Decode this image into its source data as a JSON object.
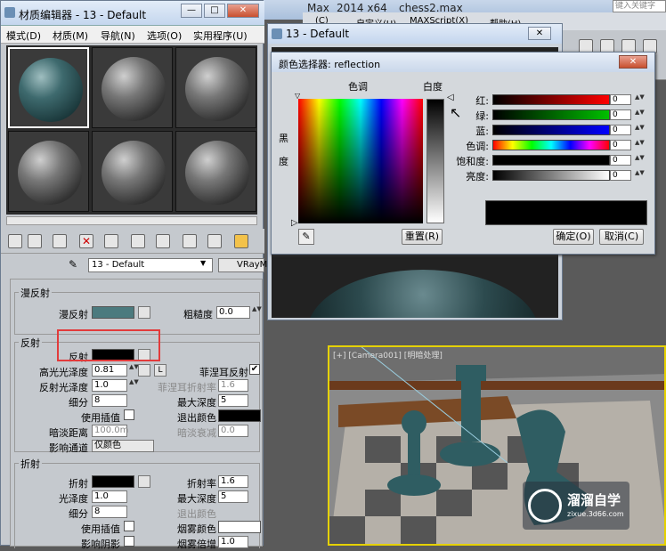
{
  "app": {
    "title_fragments": [
      "Max",
      "2014 x64",
      "chess2.max"
    ],
    "search_placeholder": "键入关键字",
    "menu_fragments": [
      "(C)",
      "自定义(U)",
      "MAXScript(X)",
      "帮助(H)"
    ]
  },
  "viewport": {
    "label": "[+] [Camera001] [明暗处理]"
  },
  "material_editor": {
    "title": "材质编辑器 - 13 - Default",
    "window_buttons": [
      "—",
      "□",
      "✕"
    ],
    "menu": [
      "模式(D)",
      "材质(M)",
      "导航(N)",
      "选项(O)",
      "实用程序(U)"
    ],
    "material_name": "13 - Default",
    "material_type": "VRayMt",
    "diffuse": {
      "header": "漫反射",
      "diffuse_label": "漫反射",
      "diffuse_color": "#4b7a7e",
      "roughness_label": "粗糙度",
      "roughness_value": "0.0"
    },
    "reflection": {
      "header": "反射",
      "reflect_label": "反射",
      "reflect_color": "#000000",
      "hilight_gloss_label": "高光光泽度",
      "hilight_gloss_value": "0.81",
      "lock_label": "L",
      "fresnel_label": "菲涅耳反射",
      "fresnel_checked": "✔",
      "refl_gloss_label": "反射光泽度",
      "refl_gloss_value": "1.0",
      "fresnel_ior_label": "菲涅耳折射率",
      "fresnel_ior_value": "1.6",
      "subdivs_label": "细分",
      "subdivs_value": "8",
      "max_depth_label": "最大深度",
      "max_depth_value": "5",
      "use_interp_label": "使用插值",
      "exit_color_label": "退出颜色",
      "exit_color": "#000000",
      "dim_dist_label": "暗淡距离",
      "dim_dist_value": "100.0m",
      "dim_falloff_label": "暗淡衰减",
      "dim_falloff_value": "0.0",
      "affect_channels_label": "影响通道",
      "affect_channels_value": "仅颜色"
    },
    "refraction": {
      "header": "折射",
      "refract_label": "折射",
      "refract_color": "#000000",
      "ior_label": "折射率",
      "ior_value": "1.6",
      "gloss_label": "光泽度",
      "gloss_value": "1.0",
      "max_depth_label": "最大深度",
      "max_depth_value": "5",
      "subdivs_label": "细分",
      "subdivs_value": "8",
      "exit_color_label": "退出颜色",
      "use_interp_label": "使用插值",
      "fog_color_label": "烟雾颜色",
      "fog_color": "#ffffff",
      "affect_shadows_label": "影响阴影",
      "fog_mult_label": "烟雾倍增",
      "fog_mult_value": "1.0"
    }
  },
  "material_dialog": {
    "title": "13 - Default"
  },
  "color_picker": {
    "title": "颜色选择器: reflection",
    "hue_label": "色调",
    "whiteness_label": "白度",
    "blackness_label": "黑\n\n度",
    "channels": [
      {
        "label": "红:",
        "value": "0",
        "color_from": "#000000",
        "color_to": "#ff0000"
      },
      {
        "label": "绿:",
        "value": "0",
        "color_from": "#000000",
        "color_to": "#00c000"
      },
      {
        "label": "蓝:",
        "value": "0",
        "color_from": "#000000",
        "color_to": "#0000ff"
      },
      {
        "label": "色调:",
        "value": "0",
        "color_from": "#ff0000",
        "color_to": "#ff0000"
      },
      {
        "label": "饱和度:",
        "value": "0",
        "color_from": "#000000",
        "color_to": "#000000"
      },
      {
        "label": "亮度:",
        "value": "0",
        "color_from": "#000000",
        "color_to": "#ffffff"
      }
    ],
    "reset_button": "重置(R)",
    "ok_button": "确定(O)",
    "cancel_button": "取消(C)",
    "current_color": "#000000"
  },
  "watermark": {
    "name": "溜溜自学",
    "url": "zixue.3d66.com"
  }
}
